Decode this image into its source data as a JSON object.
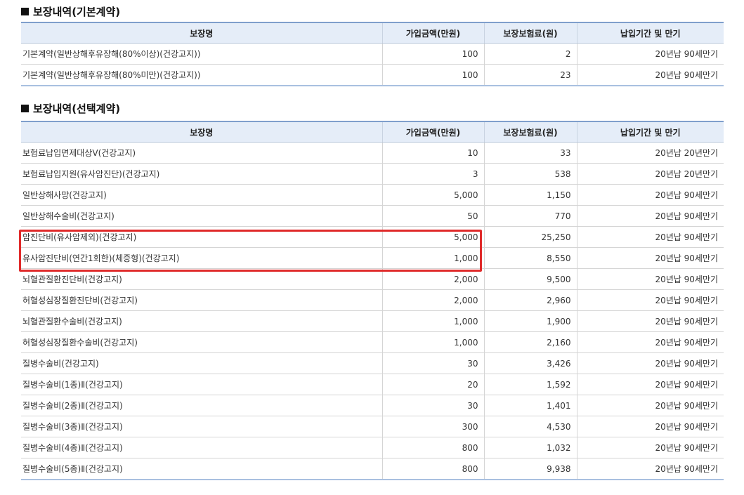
{
  "section_basic": {
    "title": "보장내역(기본계약)",
    "headers": [
      "보장명",
      "가입금액(만원)",
      "보장보험료(원)",
      "납입기간 및 만기"
    ],
    "rows": [
      [
        "기본계약(일반상해후유장해(80%이상)(건강고지))",
        "100",
        "2",
        "20년납 90세만기"
      ],
      [
        "기본계약(일반상해후유장해(80%미만)(건강고지))",
        "100",
        "23",
        "20년납 90세만기"
      ]
    ]
  },
  "section_optional": {
    "title": "보장내역(선택계약)",
    "headers": [
      "보장명",
      "가입금액(만원)",
      "보장보험료(원)",
      "납입기간 및 만기"
    ],
    "rows": [
      [
        "보험료납입면제대상Ⅴ(건강고지)",
        "10",
        "33",
        "20년납 20년만기"
      ],
      [
        "보험료납입지원(유사암진단)(건강고지)",
        "3",
        "538",
        "20년납 20년만기"
      ],
      [
        "일반상해사망(건강고지)",
        "5,000",
        "1,150",
        "20년납 90세만기"
      ],
      [
        "일반상해수술비(건강고지)",
        "50",
        "770",
        "20년납 90세만기"
      ],
      [
        "암진단비(유사암제외)(건강고지)",
        "5,000",
        "25,250",
        "20년납 90세만기"
      ],
      [
        "유사암진단비(연간1회한)(체증형)(건강고지)",
        "1,000",
        "8,550",
        "20년납 90세만기"
      ],
      [
        "뇌혈관질환진단비(건강고지)",
        "2,000",
        "9,500",
        "20년납 90세만기"
      ],
      [
        "허혈성심장질환진단비(건강고지)",
        "2,000",
        "2,960",
        "20년납 90세만기"
      ],
      [
        "뇌혈관질환수술비(건강고지)",
        "1,000",
        "1,900",
        "20년납 90세만기"
      ],
      [
        "허혈성심장질환수술비(건강고지)",
        "1,000",
        "2,160",
        "20년납 90세만기"
      ],
      [
        "질병수술비(건강고지)",
        "30",
        "3,426",
        "20년납 90세만기"
      ],
      [
        "질병수술비(1종)Ⅱ(건강고지)",
        "20",
        "1,592",
        "20년납 90세만기"
      ],
      [
        "질병수술비(2종)Ⅱ(건강고지)",
        "30",
        "1,401",
        "20년납 90세만기"
      ],
      [
        "질병수술비(3종)Ⅱ(건강고지)",
        "300",
        "4,530",
        "20년납 90세만기"
      ],
      [
        "질병수술비(4종)Ⅱ(건강고지)",
        "800",
        "1,032",
        "20년납 90세만기"
      ],
      [
        "질병수술비(5종)Ⅱ(건강고지)",
        "800",
        "9,938",
        "20년납 90세만기"
      ]
    ]
  },
  "highlight": {
    "color": "#e02a2a",
    "rows": [
      "암진단비(유사암제외)(건강고지)",
      "유사암진단비(연간1회한)(체증형)(건강고지)"
    ]
  },
  "colors": {
    "header_bg": "#e5edf8",
    "table_border": "#7f9fcc"
  }
}
